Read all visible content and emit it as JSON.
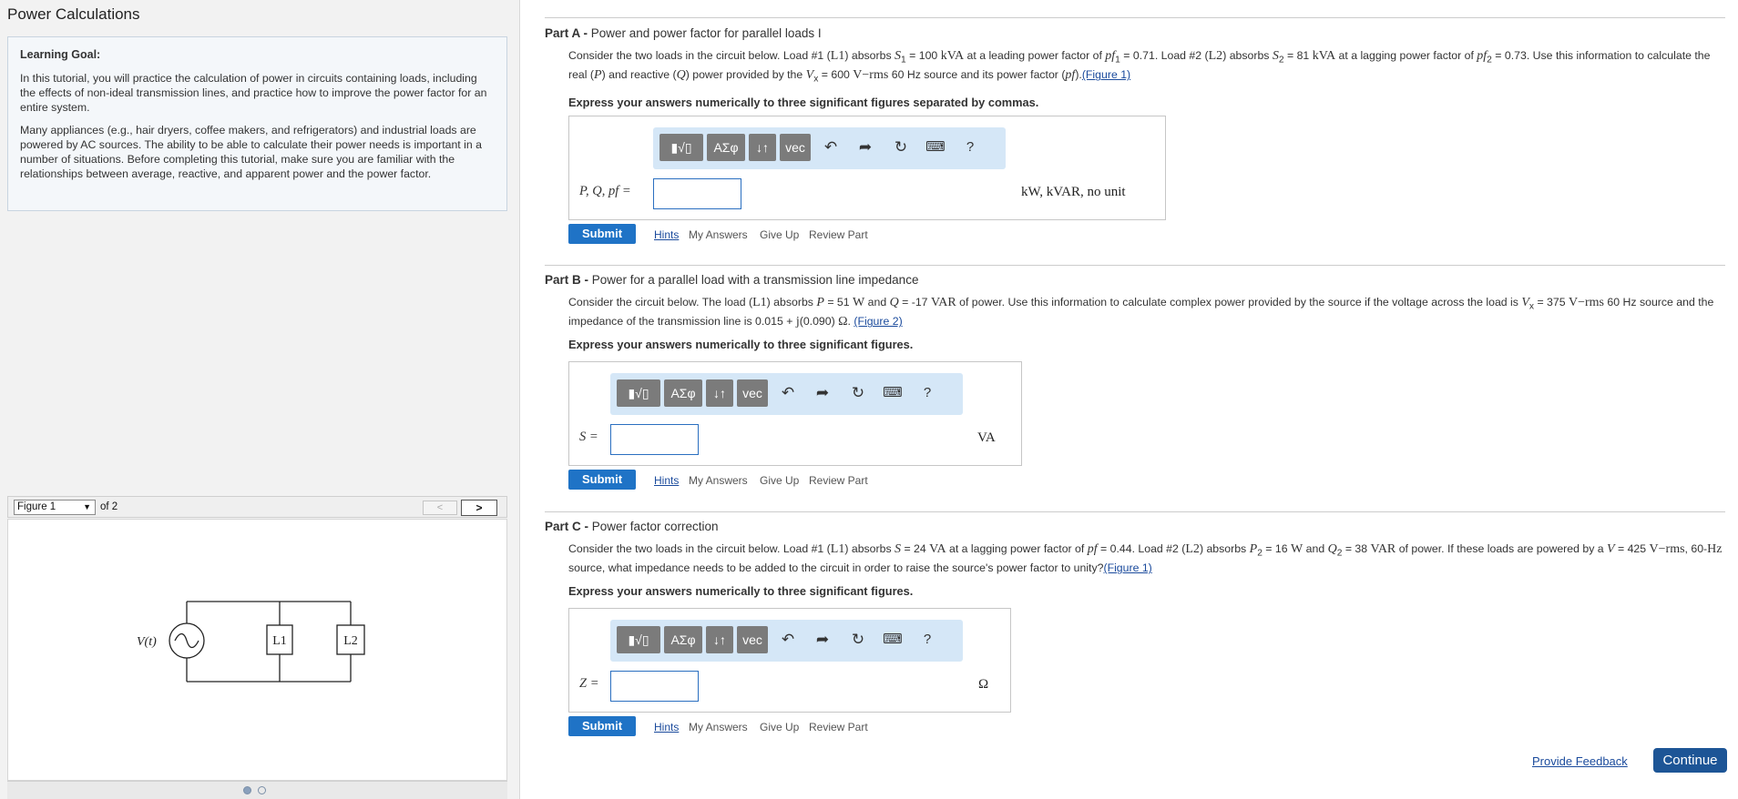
{
  "page": {
    "title": "Power Calculations"
  },
  "goal": {
    "heading": "Learning Goal:",
    "p1": "In this tutorial, you will practice the calculation of power in circuits containing loads, including the effects of non-ideal transmission lines, and practice how to improve the power factor for an entire system.",
    "p2": "Many appliances (e.g., hair dryers, coffee makers, and refrigerators) and industrial loads are powered by AC sources. The ability to be able to calculate their power needs is important in a number of situations. Before completing this tutorial, make sure you are familiar with the relationships between average, reactive, and apparent power and the power factor."
  },
  "figure_nav": {
    "selected": "Figure 1",
    "of_text": "of 2",
    "prev": "<",
    "next": ">"
  },
  "figure": {
    "source_label": "V(t)",
    "load1": "L1",
    "load2": "L2"
  },
  "toolbar": {
    "templates": "▮√▯",
    "greek": "AΣφ",
    "arrows": "↓↑",
    "vec": "vec",
    "help": "?"
  },
  "actions": {
    "submit": "Submit",
    "hints": "Hints",
    "my_answers": "My Answers",
    "give_up": "Give Up",
    "review_part": "Review Part"
  },
  "partA": {
    "label": "Part A -",
    "title": " Power and power factor for parallel loads I",
    "instruction": "Express your answers numerically to three significant figures separated by commas.",
    "answer_label": "P, Q, pf =",
    "unit": "kW, kVAR, no unit",
    "figure_link": "(Figure 1)"
  },
  "partB": {
    "label": "Part B -",
    "title": " Power for a parallel load with a transmission line impedance",
    "instruction": "Express your answers numerically to three significant figures.",
    "answer_label": "S =",
    "unit": "VA",
    "figure_link": "(Figure 2)"
  },
  "partC": {
    "label": "Part C -",
    "title": " Power factor correction",
    "instruction": "Express your answers numerically to three significant figures.",
    "answer_label": "Z =",
    "unit": "Ω",
    "figure_link": "(Figure 1)"
  },
  "footer": {
    "feedback": "Provide Feedback",
    "continue": "Continue"
  }
}
